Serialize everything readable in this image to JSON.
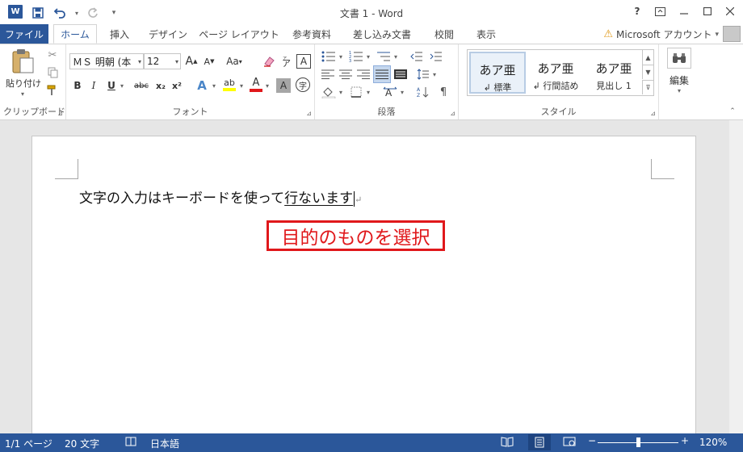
{
  "window": {
    "title": "文書 1 - Word",
    "help": "?",
    "restore_ribbon": "▣",
    "minimize": "—",
    "maximize": "☐",
    "close": "✕"
  },
  "qat": {
    "logo": "W",
    "save_icon": "save-icon",
    "undo_icon": "undo-icon",
    "redo_icon": "redo-icon",
    "customize": "▾"
  },
  "tabs": {
    "file": "ファイル",
    "items": [
      "ホーム",
      "挿入",
      "デザイン",
      "ページ レイアウト",
      "参考資料",
      "差し込み文書",
      "校閲",
      "表示"
    ],
    "active": "ホーム"
  },
  "account": {
    "label": "Microsoft アカウント",
    "dropdown": "▾"
  },
  "ribbon": {
    "clipboard": {
      "paste": "貼り付け",
      "label": "クリップボード"
    },
    "font": {
      "font_name": "ＭＳ 明朝 (本",
      "font_size": "12",
      "grow": "A",
      "shrink": "A",
      "case": "Aa",
      "bold": "B",
      "italic": "I",
      "underline": "U",
      "strike": "abc",
      "subscript": "x₂",
      "superscript": "x²",
      "text_effect": "A",
      "highlight": "ab",
      "font_color": "A",
      "char_shading": "A",
      "enclose": "字",
      "label": "フォント"
    },
    "paragraph": {
      "label": "段落"
    },
    "styles": {
      "items": [
        {
          "sample": "あア亜",
          "name": "↲ 標準"
        },
        {
          "sample": "あア亜",
          "name": "↲ 行間詰め"
        },
        {
          "sample": "あア亜",
          "name": "見出し 1"
        }
      ],
      "label": "スタイル"
    },
    "editing": {
      "label": "編集"
    }
  },
  "document": {
    "text_before": "文字の入力はキーボードを使って",
    "text_selected": "行ないます",
    "para_mark": "↵",
    "callout": "目的のものを選択"
  },
  "status": {
    "page": "1/1 ページ",
    "words": "20 文字",
    "language": "日本語",
    "zoom": "120%",
    "zoom_minus": "−",
    "zoom_plus": "+",
    "accent_color": "#2b579a"
  }
}
